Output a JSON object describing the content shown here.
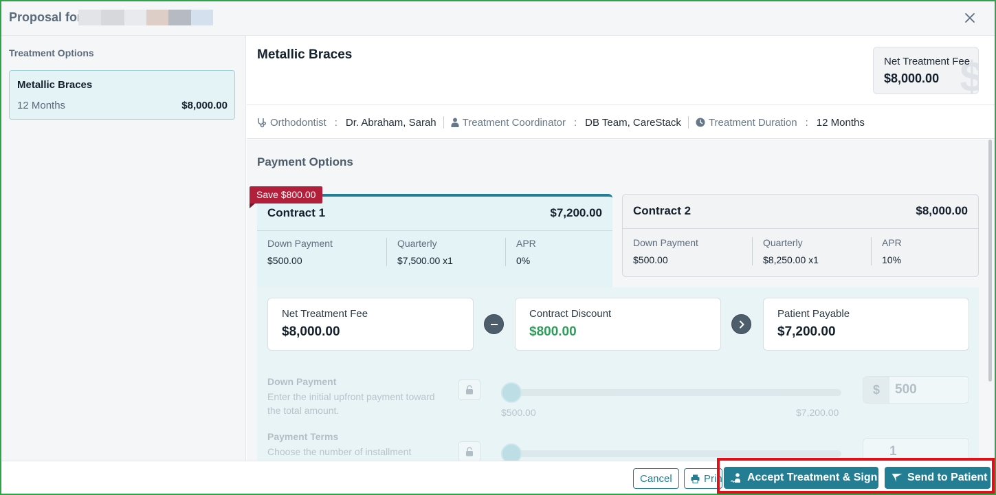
{
  "header": {
    "title": "Proposal for"
  },
  "left": {
    "section_label": "Treatment Options",
    "options": [
      {
        "name": "Metallic Braces",
        "duration": "12 Months",
        "price": "$8,000.00"
      }
    ]
  },
  "treatment": {
    "title": "Metallic Braces",
    "net_fee_label": "Net Treatment Fee",
    "net_fee_value": "$8,000.00",
    "net_fee_watermark": "$"
  },
  "meta": {
    "orthodontist_label": "Orthodontist",
    "orthodontist_value": "Dr. Abraham, Sarah",
    "coordinator_label": "Treatment Coordinator",
    "coordinator_value": "DB Team, CareStack",
    "duration_label": "Treatment Duration",
    "duration_value": "12 Months",
    "colon": ":"
  },
  "payment": {
    "title": "Payment Options",
    "contracts": [
      {
        "name": "Contract 1",
        "total": "$7,200.00",
        "badge": "Save $800.00",
        "cols": [
          {
            "label": "Down Payment",
            "value": "$500.00"
          },
          {
            "label": "Quarterly",
            "value": "$7,500.00 x1"
          },
          {
            "label": "APR",
            "value": "0%"
          }
        ]
      },
      {
        "name": "Contract 2",
        "total": "$8,000.00",
        "cols": [
          {
            "label": "Down Payment",
            "value": "$500.00"
          },
          {
            "label": "Quarterly",
            "value": "$8,250.00 x1"
          },
          {
            "label": "APR",
            "value": "10%"
          }
        ]
      }
    ],
    "calc": {
      "net_fee_label": "Net Treatment Fee",
      "net_fee_value": "$8,000.00",
      "discount_label": "Contract Discount",
      "discount_value": "$800.00",
      "payable_label": "Patient Payable",
      "payable_value": "$7,200.00"
    },
    "down_payment": {
      "label": "Down Payment",
      "desc": "Enter the initial upfront payment toward the total amount.",
      "min": "$500.00",
      "max": "$7,200.00",
      "currency": "$",
      "amount": "500"
    },
    "payment_terms": {
      "label": "Payment Terms",
      "desc": "Choose the number of installment",
      "amount": "1"
    }
  },
  "footer": {
    "cancel": "Cancel",
    "print": "Print",
    "accept": "Accept Treatment & Sign",
    "send": "Send to Patient"
  },
  "colors": {
    "accent": "#247e93",
    "badge": "#b21f3b",
    "discount": "#2e9e5b",
    "highlight": "#e0101a"
  }
}
